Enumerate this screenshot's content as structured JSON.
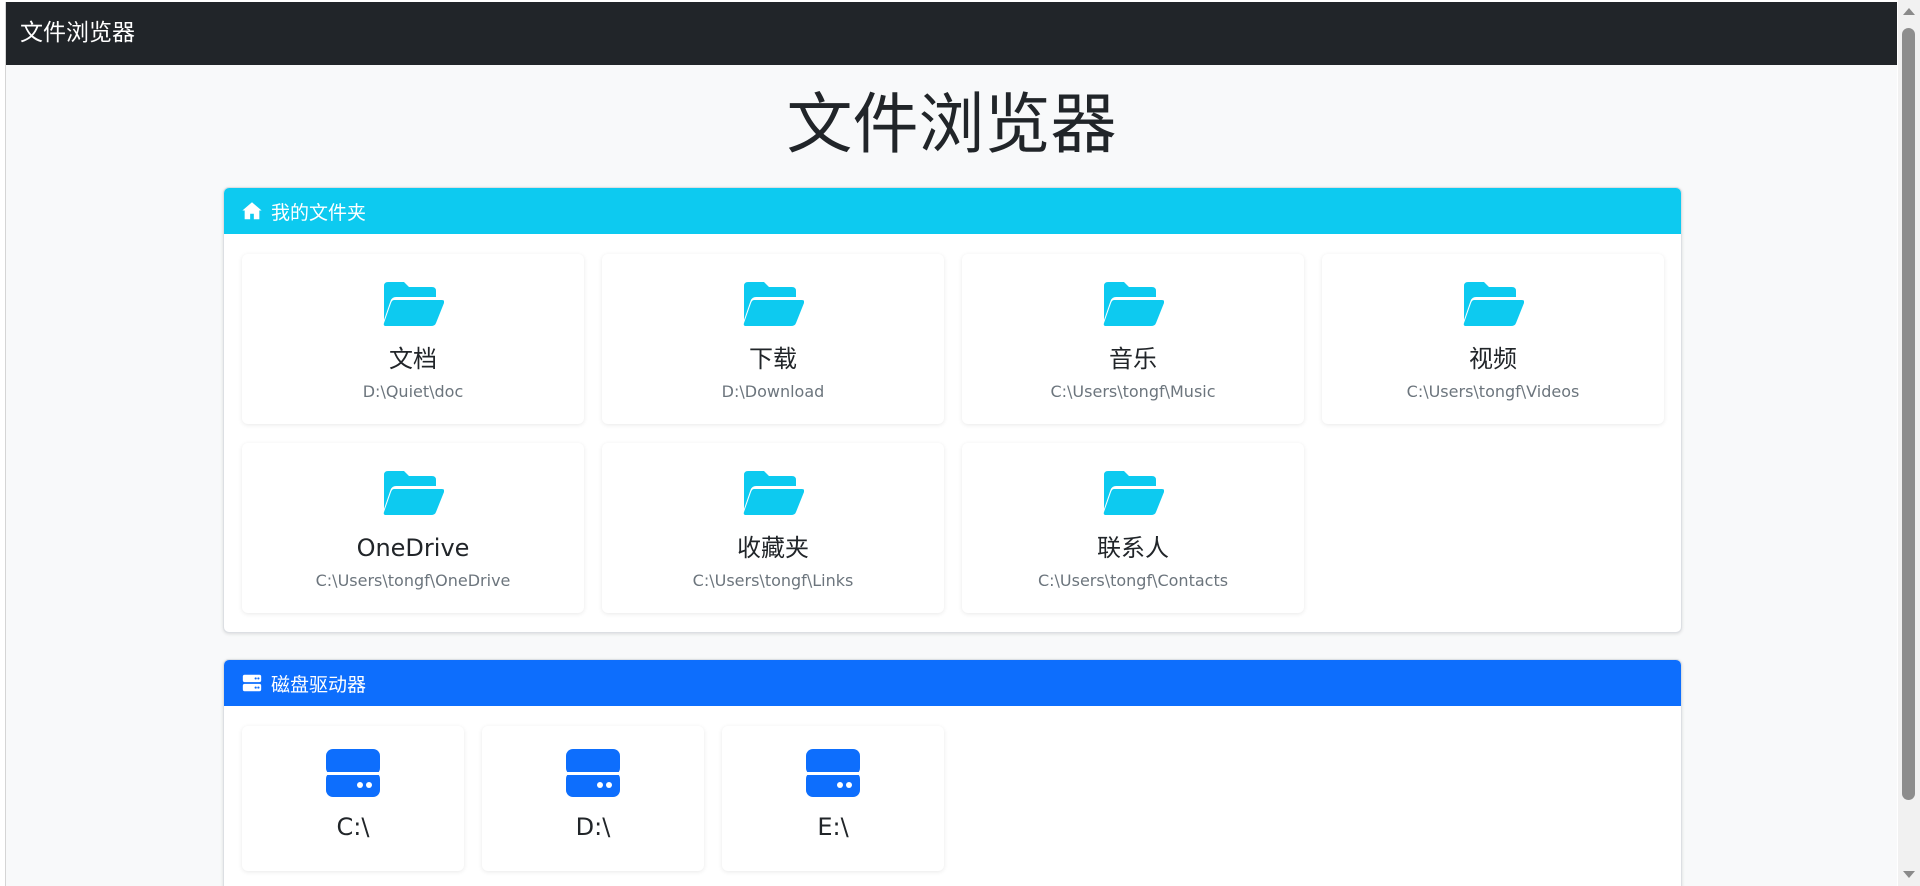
{
  "navbar": {
    "brand": "文件浏览器"
  },
  "page": {
    "title": "文件浏览器"
  },
  "folders_section": {
    "header": "我的文件夹",
    "icon": "home-icon",
    "accent": "#0dcaf0",
    "items": [
      {
        "name": "文档",
        "path": "D:\\Quiet\\doc"
      },
      {
        "name": "下载",
        "path": "D:\\Download"
      },
      {
        "name": "音乐",
        "path": "C:\\Users\\tongf\\Music"
      },
      {
        "name": "视频",
        "path": "C:\\Users\\tongf\\Videos"
      },
      {
        "name": "OneDrive",
        "path": "C:\\Users\\tongf\\OneDrive"
      },
      {
        "name": "收藏夹",
        "path": "C:\\Users\\tongf\\Links"
      },
      {
        "name": "联系人",
        "path": "C:\\Users\\tongf\\Contacts"
      }
    ]
  },
  "drives_section": {
    "header": "磁盘驱动器",
    "icon": "hdd-icon",
    "accent": "#0d6efd",
    "items": [
      {
        "label": "C:\\"
      },
      {
        "label": "D:\\"
      },
      {
        "label": "E:\\"
      }
    ]
  }
}
